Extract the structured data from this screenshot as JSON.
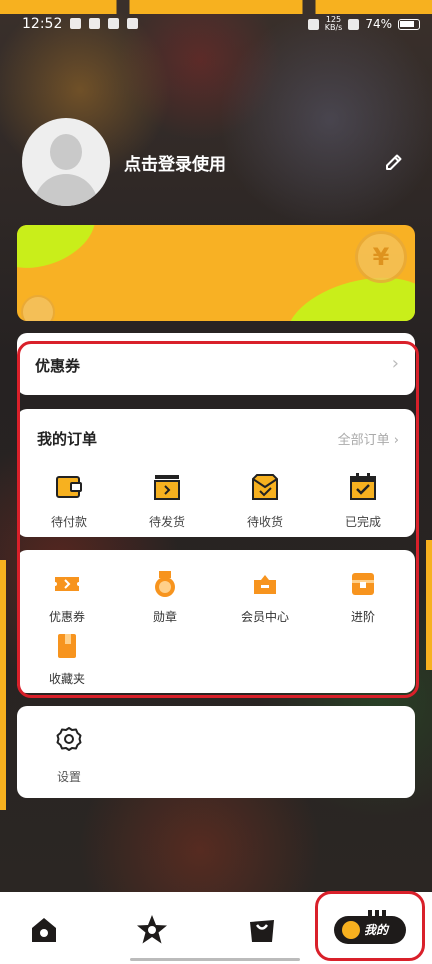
{
  "status_bar": {
    "time": "12:52",
    "net_speed_value": "125",
    "net_speed_unit": "KB/s",
    "battery": "74%"
  },
  "profile": {
    "login_text": "点击登录使用",
    "avatar_icon": "avatar-placeholder-icon",
    "edit_icon": "pencil-icon"
  },
  "coupon_row": {
    "title": "优惠券",
    "chevron": "›"
  },
  "orders": {
    "title": "我的订单",
    "view_all": "全部订单 ›",
    "items": [
      {
        "label": "待付款",
        "icon": "wallet-icon"
      },
      {
        "label": "待发货",
        "icon": "box-arrow-icon"
      },
      {
        "label": "待收货",
        "icon": "package-icon"
      },
      {
        "label": "已完成",
        "icon": "calendar-check-icon"
      }
    ]
  },
  "features": {
    "items": [
      {
        "label": "优惠券",
        "icon": "ticket-icon"
      },
      {
        "label": "勋章",
        "icon": "medal-icon"
      },
      {
        "label": "会员中心",
        "icon": "crown-box-icon"
      },
      {
        "label": "进阶",
        "icon": "treasure-chest-icon"
      },
      {
        "label": "收藏夹",
        "icon": "folder-icon"
      }
    ]
  },
  "settings": {
    "label": "设置",
    "icon": "gear-icon"
  },
  "tabbar": {
    "tabs": [
      {
        "name": "home",
        "icon": "home-icon"
      },
      {
        "name": "discover",
        "icon": "star-icon"
      },
      {
        "name": "shop",
        "icon": "bag-icon"
      }
    ],
    "active_label": "我的"
  },
  "colors": {
    "accent": "#f7b11f",
    "lime": "#c9ee1a",
    "highlight": "#d9202a",
    "dark": "#1e1b1a"
  }
}
